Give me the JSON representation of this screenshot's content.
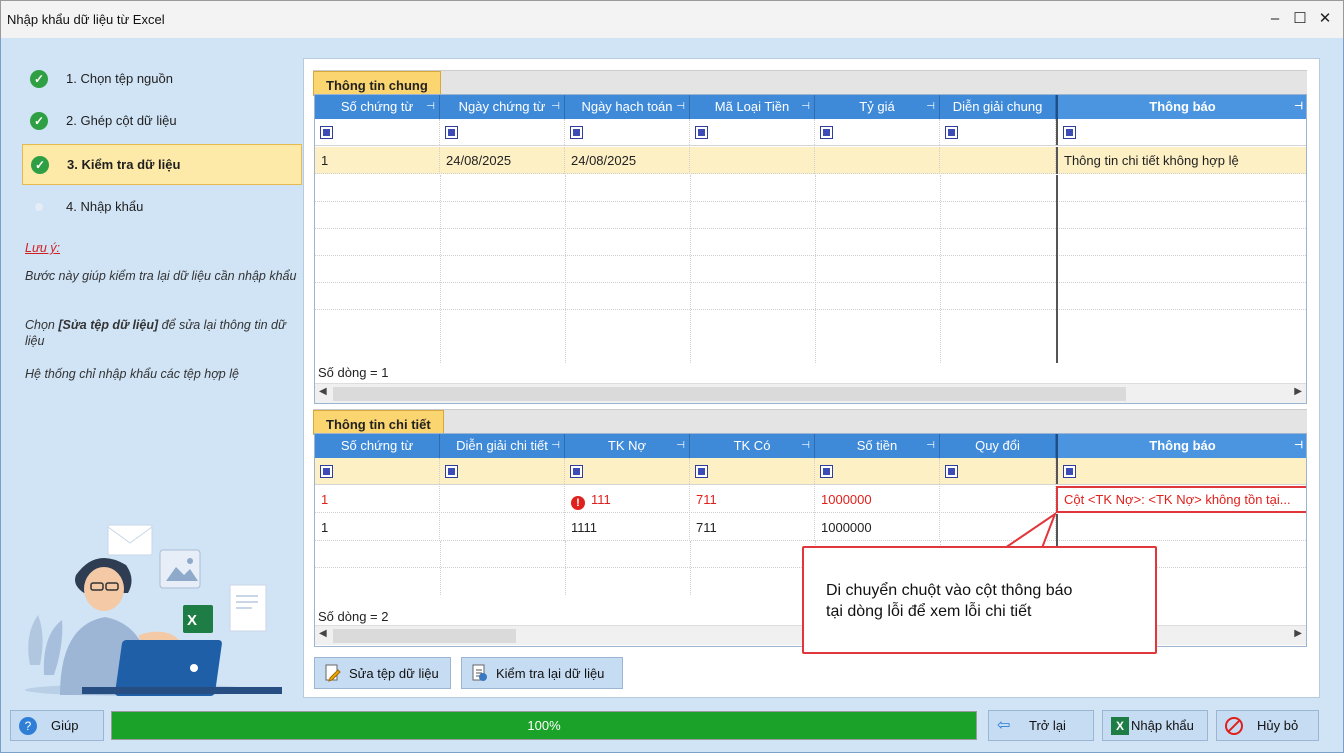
{
  "window": {
    "title": "Nhập khẩu dữ liệu từ Excel",
    "controls": [
      "–",
      "☐",
      "✕"
    ]
  },
  "steps": [
    {
      "label": "1. Chọn tệp nguồn",
      "status": "done"
    },
    {
      "label": "2. Ghép cột dữ liệu",
      "status": "done"
    },
    {
      "label": "3. Kiểm tra dữ liệu",
      "status": "active"
    },
    {
      "label": "4. Nhập khẩu",
      "status": "pending"
    }
  ],
  "notes": {
    "title": "Lưu ý:",
    "p1": "Bước này giúp kiểm tra lại dữ liệu cần nhập khẩu",
    "p2_pre": "Chọn ",
    "p2_bold": "[Sửa tệp dữ liệu]",
    "p2_post": " để sửa lại thông tin dữ liệu",
    "p3": "Hệ thống chỉ nhập khẩu các tệp hợp lệ"
  },
  "general": {
    "tab": "Thông tin chung",
    "columns": [
      "Số chứng từ",
      "Ngày chứng từ",
      "Ngày hạch toán",
      "Mã Loại Tiền",
      "Tỷ giá",
      "Diễn giải chung",
      "Thông báo"
    ],
    "rows": [
      [
        "1",
        "24/08/2025",
        "24/08/2025",
        "",
        "",
        "",
        "Thông tin chi tiết không hợp lệ"
      ]
    ],
    "footer": "Số dòng = 1"
  },
  "detail": {
    "tab": "Thông tin chi tiết",
    "columns": [
      "Số chứng từ",
      "Diễn giải chi tiết",
      "TK Nợ",
      "TK Có",
      "Số tiền",
      "Quy đổi",
      "Thông báo"
    ],
    "rows": [
      {
        "cells": [
          "1",
          "",
          "111",
          "711",
          "1000000",
          "",
          "Cột <TK Nợ>: <TK Nợ> không tồn tại..."
        ],
        "error": true
      },
      {
        "cells": [
          "1",
          "",
          "1111",
          "711",
          "1000000",
          "",
          ""
        ],
        "error": false
      }
    ],
    "footer": "Số dòng = 2"
  },
  "actions": {
    "edit": "Sửa tệp dữ liệu",
    "recheck": "Kiểm tra lại dữ liệu"
  },
  "bottom": {
    "help": "Giúp",
    "progress": "100%",
    "progress_value": 1.0,
    "back": "Trở lại",
    "import": "Nhập khẩu",
    "cancel": "Hủy bỏ"
  },
  "callout": {
    "line1": "Di chuyển chuột vào cột thông báo",
    "line2": "tại dòng lỗi để xem lỗi chi tiết"
  },
  "colors": {
    "header": "#3f8ad8",
    "tab": "#fbd56f",
    "error": "#e0201c",
    "progress": "#1aa328"
  }
}
